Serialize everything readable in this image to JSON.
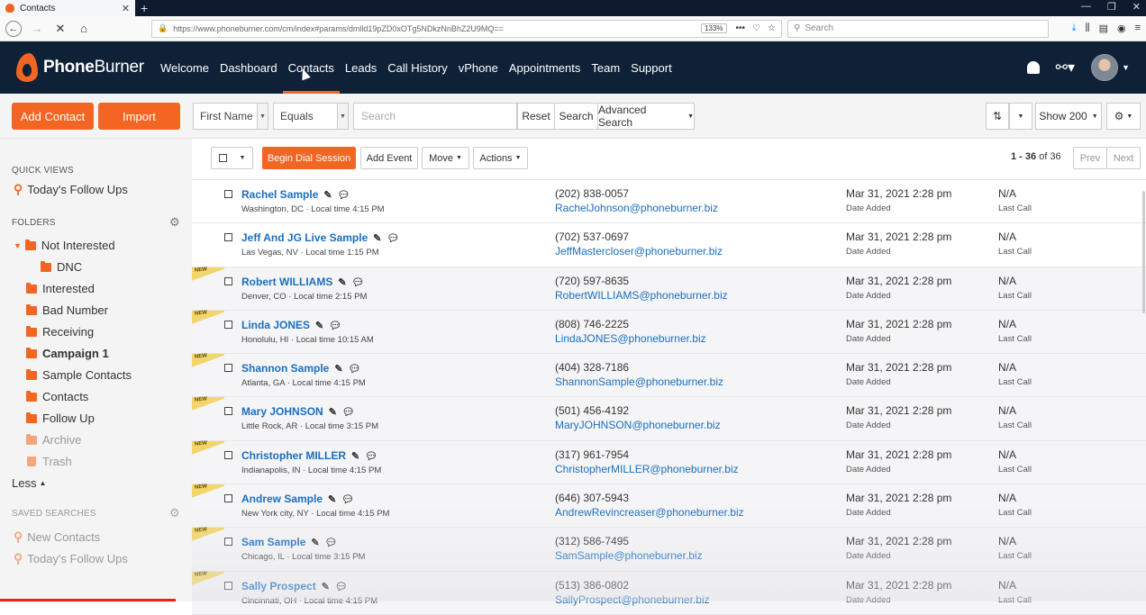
{
  "browser": {
    "tab_title": "Contacts",
    "url": "https://www.phoneburner.com/cm/index#params/dmlld19pZD0xOTg5NDkzNnBhZ2U9MQ==",
    "zoom": "133%",
    "search_placeholder": "Search"
  },
  "header": {
    "logo_bold": "Phone",
    "logo_light": "Burner",
    "nav": [
      "Welcome",
      "Dashboard",
      "Contacts",
      "Leads",
      "Call History",
      "vPhone",
      "Appointments",
      "Team",
      "Support"
    ],
    "active_nav": "Contacts",
    "accent": "#f26522"
  },
  "toolbar": {
    "add_contact": "Add Contact",
    "import": "Import",
    "field_select": "First Name",
    "operator_select": "Equals",
    "search_placeholder": "Search",
    "reset": "Reset",
    "search": "Search",
    "advanced_search": "Advanced Search",
    "show": "Show 200"
  },
  "sidebar": {
    "quick_views_title": "QUICK VIEWS",
    "quick_view": "Today's Follow Ups",
    "folders_title": "FOLDERS",
    "folders": [
      {
        "label": "Not Interested",
        "level": 0,
        "expanded": true,
        "bold": false
      },
      {
        "label": "DNC",
        "level": 1,
        "bold": false
      },
      {
        "label": "Interested",
        "level": 0,
        "bold": false
      },
      {
        "label": "Bad Number",
        "level": 0,
        "bold": false
      },
      {
        "label": "Receiving",
        "level": 0,
        "bold": false
      },
      {
        "label": "Campaign 1",
        "level": 0,
        "bold": true
      },
      {
        "label": "Sample Contacts",
        "level": 0,
        "bold": false
      },
      {
        "label": "Contacts",
        "level": 0,
        "bold": false
      },
      {
        "label": "Follow Up",
        "level": 0,
        "bold": false
      },
      {
        "label": "Archive",
        "level": 0,
        "faded": true
      },
      {
        "label": "Trash",
        "level": 0,
        "faded": true
      }
    ],
    "less": "Less",
    "saved_searches_title": "SAVED SEARCHES",
    "saved_searches": [
      "New Contacts",
      "Today's Follow Ups"
    ]
  },
  "list": {
    "begin_dial": "Begin Dial Session",
    "add_event": "Add Event",
    "move": "Move",
    "actions": "Actions",
    "count_range": "1 - 36",
    "count_of": "of 36",
    "prev": "Prev",
    "next": "Next",
    "new_badge": "NEW",
    "date_label": "Date Added",
    "last_call_label": "Last Call",
    "contacts": [
      {
        "name": "Rachel Sample",
        "loc": "Washington, DC · Local time 4:15 PM",
        "phone": "(202) 838-0057",
        "email": "RachelJohnson@phoneburner.biz",
        "date": "Mar 31, 2021 2:28 pm",
        "last": "N/A",
        "new": false
      },
      {
        "name": "Jeff And JG Live Sample",
        "loc": "Las Vegas, NV · Local time 1:15 PM",
        "phone": "(702) 537-0697",
        "email": "JeffMastercloser@phoneburner.biz",
        "date": "Mar 31, 2021 2:28 pm",
        "last": "N/A",
        "new": false
      },
      {
        "name": "Robert WILLIAMS",
        "loc": "Denver, CO · Local time 2:15 PM",
        "phone": "(720) 597-8635",
        "email": "RobertWILLIAMS@phoneburner.biz",
        "date": "Mar 31, 2021 2:28 pm",
        "last": "N/A",
        "new": true
      },
      {
        "name": "Linda JONES",
        "loc": "Honolulu, HI · Local time 10:15 AM",
        "phone": "(808) 746-2225",
        "email": "LindaJONES@phoneburner.biz",
        "date": "Mar 31, 2021 2:28 pm",
        "last": "N/A",
        "new": true
      },
      {
        "name": "Shannon Sample",
        "loc": "Atlanta, GA · Local time 4:15 PM",
        "phone": "(404) 328-7186",
        "email": "ShannonSample@phoneburner.biz",
        "date": "Mar 31, 2021 2:28 pm",
        "last": "N/A",
        "new": true
      },
      {
        "name": "Mary JOHNSON",
        "loc": "Little Rock, AR · Local time 3:15 PM",
        "phone": "(501) 456-4192",
        "email": "MaryJOHNSON@phoneburner.biz",
        "date": "Mar 31, 2021 2:28 pm",
        "last": "N/A",
        "new": true
      },
      {
        "name": "Christopher MILLER",
        "loc": "Indianapolis, IN · Local time 4:15 PM",
        "phone": "(317) 961-7954",
        "email": "ChristopherMILLER@phoneburner.biz",
        "date": "Mar 31, 2021 2:28 pm",
        "last": "N/A",
        "new": true
      },
      {
        "name": "Andrew Sample",
        "loc": "New York city, NY · Local time 4:15 PM",
        "phone": "(646) 307-5943",
        "email": "AndrewRevincreaser@phoneburner.biz",
        "date": "Mar 31, 2021 2:28 pm",
        "last": "N/A",
        "new": true
      },
      {
        "name": "Sam Sample",
        "loc": "Chicago, IL · Local time 3:15 PM",
        "phone": "(312) 586-7495",
        "email": "SamSample@phoneburner.biz",
        "date": "Mar 31, 2021 2:28 pm",
        "last": "N/A",
        "new": true
      },
      {
        "name": "Sally Prospect",
        "loc": "Cincinnati, OH · Local time 4:15 PM",
        "phone": "(513) 386-0802",
        "email": "SallyProspect@phoneburner.biz",
        "date": "Mar 31, 2021 2:28 pm",
        "last": "N/A",
        "new": true
      }
    ]
  }
}
